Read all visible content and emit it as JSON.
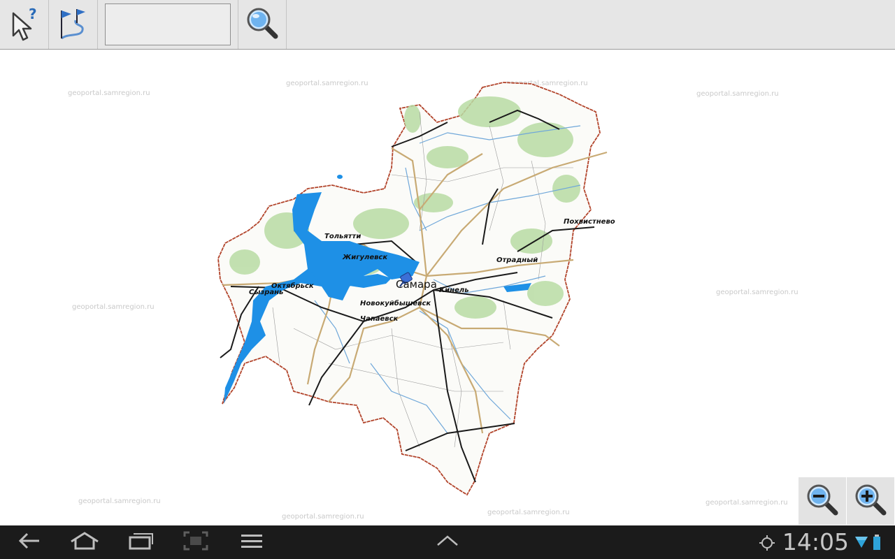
{
  "toolbar": {
    "tools": [
      "help-pointer",
      "route-flags",
      "search"
    ],
    "search_value": ""
  },
  "map": {
    "watermark": "geoportal.samregion.ru",
    "cities": {
      "samara": "Самара",
      "tolyatti": "Тольятти",
      "zhigulevsk": "Жигулевск",
      "syzran": "Сызрань",
      "oktyabrsk": "Октябрьск",
      "novokuibyshevsk": "Новокуйбышевск",
      "chapaevsk": "Чапаевск",
      "kinel": "Кинель",
      "otradny": "Отрадный",
      "pokhvistnevo": "Похвистнево"
    },
    "colors": {
      "border": "#b2442b",
      "water": "#1e90e6",
      "forest": "#b9dca4",
      "road": "#c8aa74",
      "rail": "#1a1a1a",
      "river": "#6fa7d9"
    }
  },
  "zoom": {
    "out": "zoom-out",
    "in": "zoom-in"
  },
  "statusbar": {
    "time": "14:05"
  },
  "navbar": {
    "buttons": [
      "back",
      "home",
      "recent-apps",
      "screenshot",
      "menu",
      "show-notifications"
    ]
  }
}
